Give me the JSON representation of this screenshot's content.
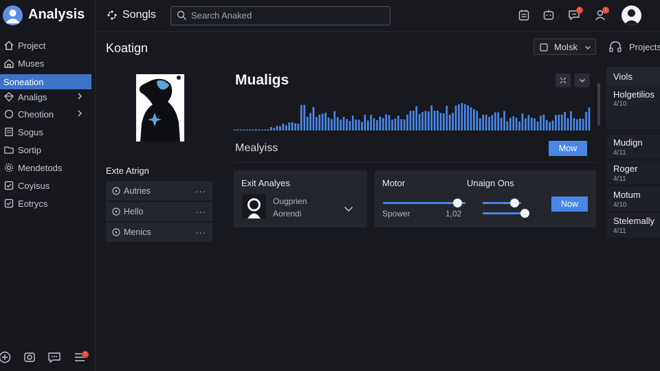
{
  "app": {
    "title": "Analysis"
  },
  "sidebar": {
    "items": [
      {
        "label": "Project",
        "icon": "home-icon"
      },
      {
        "label": "Muses",
        "icon": "house-icon"
      },
      {
        "label": "Soneation",
        "icon": "",
        "active": true
      },
      {
        "label": "Analigs",
        "icon": "diamond-icon",
        "has_chevron": true
      },
      {
        "label": "Cheotion",
        "icon": "circle-icon",
        "has_chevron": true
      },
      {
        "label": "Sogus",
        "icon": "document-icon"
      },
      {
        "label": "Sortip",
        "icon": "folder-icon"
      },
      {
        "label": "Mendetods",
        "icon": "gear-icon"
      },
      {
        "label": "Coyisus",
        "icon": "check-square-icon"
      },
      {
        "label": "Eotrycs",
        "icon": "checkbox-icon"
      }
    ],
    "bottom_icons": [
      "plus-circle-icon",
      "camera-icon",
      "chat-icon",
      "list-icon"
    ],
    "bottom_badge": "!"
  },
  "topbar": {
    "songs_label": "Songls",
    "search_placeholder": "Search Anaked",
    "badge_text": "!"
  },
  "left": {
    "section_title": "Koatign",
    "assign_title": "Exte Atrign",
    "list": [
      {
        "label": "Autries"
      },
      {
        "label": "Hello"
      },
      {
        "label": "Menics"
      }
    ],
    "more_label": "···"
  },
  "main": {
    "select_value": "Molsk",
    "projects_label": "Projects",
    "chart_title": "Mualigs",
    "analysis_label": "Mealyiss",
    "now_button": "Mow",
    "card1": {
      "title": "Exit Analyes",
      "line1": "Ougprien",
      "line2": "Aorendi"
    },
    "card2": {
      "motor_label": "Motor",
      "options_label": "Unaign Ons",
      "spower_label": "Spower",
      "value_label": "1,02",
      "button_label": "Now",
      "slider_levels": [
        0.9,
        0.82,
        0.95
      ]
    },
    "accent": "#4a86e8"
  },
  "right_panel": {
    "header": "Viols",
    "items": [
      {
        "title": "Holgetilios",
        "sub": "4/10"
      },
      {
        "title": "Mudign",
        "sub": "4/11"
      },
      {
        "title": "Roger",
        "sub": "4/11"
      },
      {
        "title": "Motum",
        "sub": "4/10"
      },
      {
        "title": "Stelemally",
        "sub": "4/11"
      }
    ]
  }
}
